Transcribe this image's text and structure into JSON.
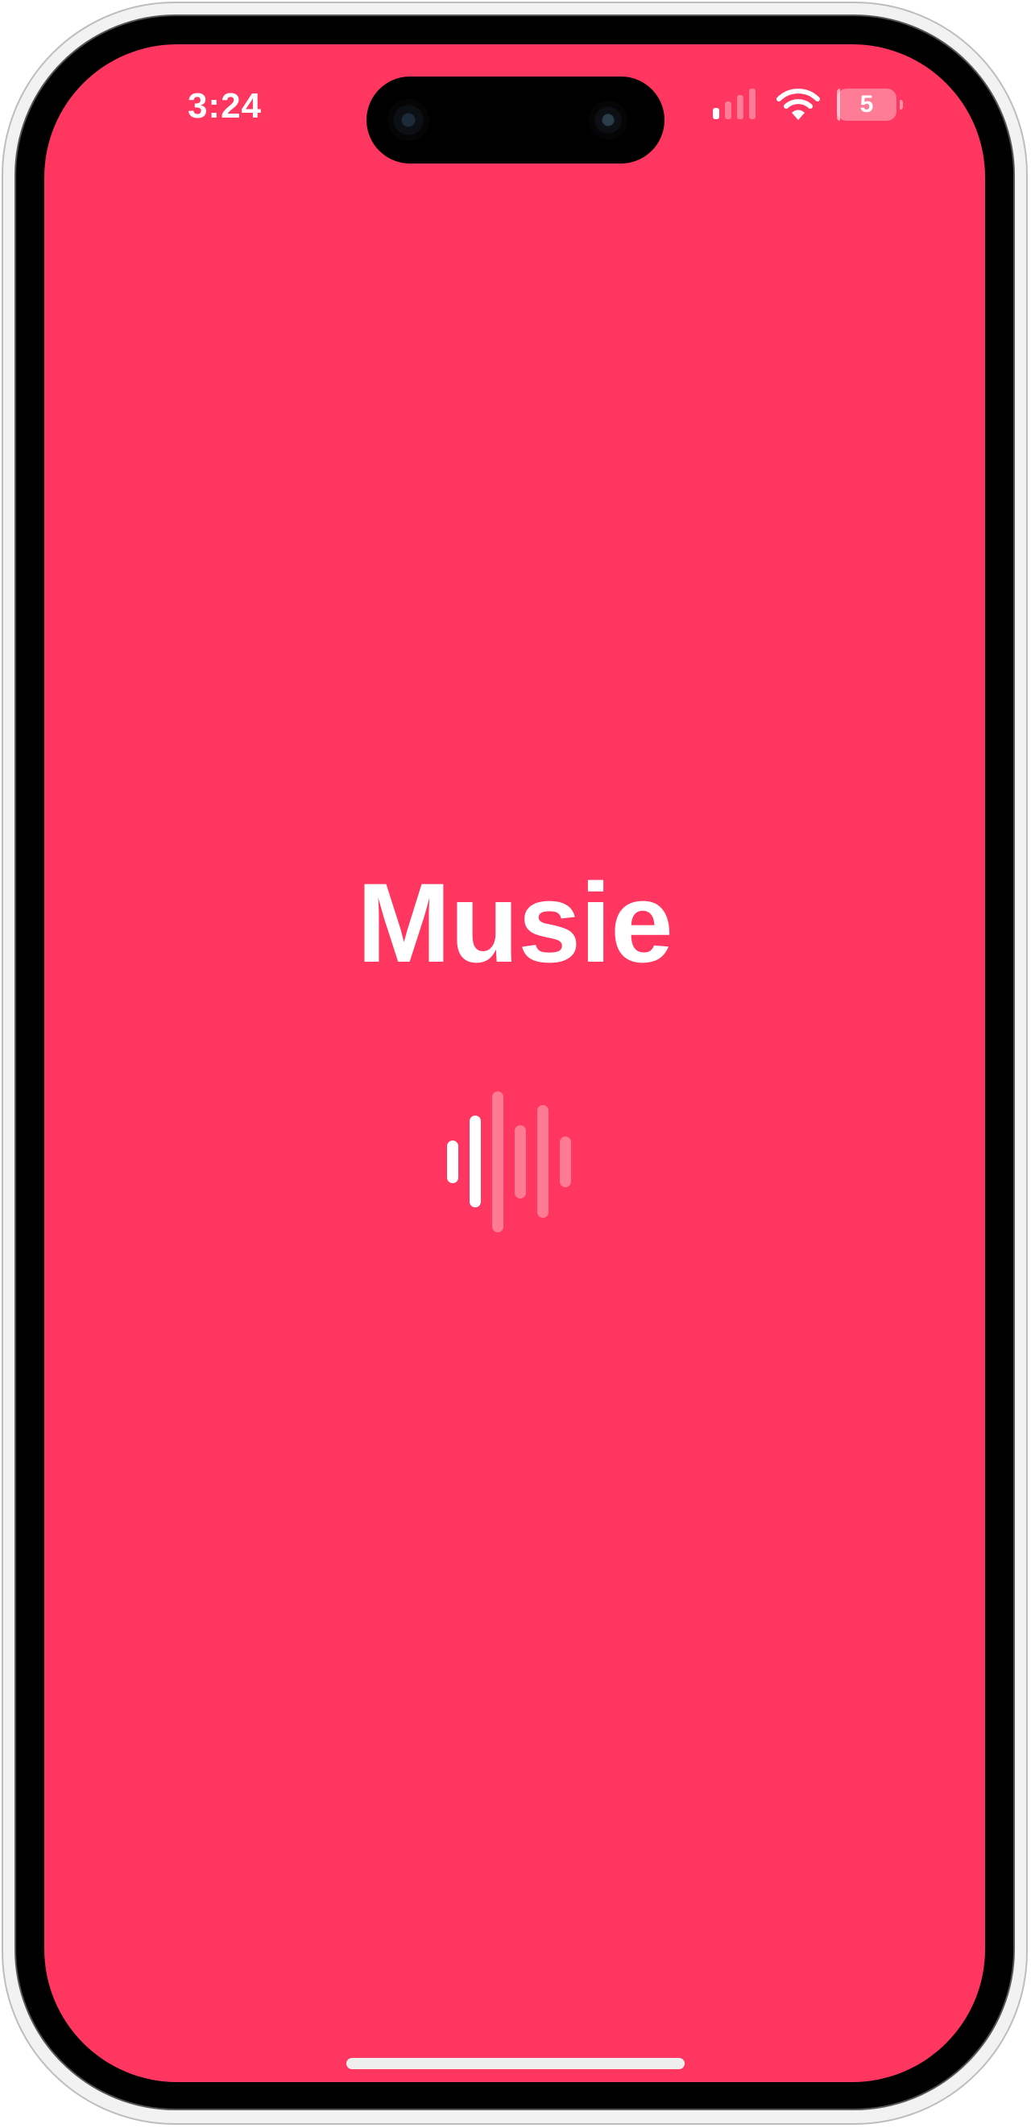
{
  "colors": {
    "background": "#ff365f",
    "foreground": "#ffffff",
    "wave_dim": "#ff7a93"
  },
  "status_bar": {
    "time": "3:24",
    "signal_icon": "cellular-signal-icon",
    "signal_bars_active": 1,
    "signal_bars_total": 4,
    "wifi_icon": "wifi-icon",
    "battery_icon": "battery-icon",
    "battery_label": "5",
    "battery_fraction": 0.05
  },
  "splash": {
    "app_name": "Musie",
    "logo_icon": "audio-waveform-icon",
    "waveform_bars": [
      {
        "level": 0.3,
        "bright": true
      },
      {
        "level": 0.65,
        "bright": true
      },
      {
        "level": 1.0,
        "bright": false
      },
      {
        "level": 0.52,
        "bright": false
      },
      {
        "level": 0.8,
        "bright": false
      },
      {
        "level": 0.36,
        "bright": false
      }
    ]
  },
  "home_indicator_icon": "home-indicator"
}
